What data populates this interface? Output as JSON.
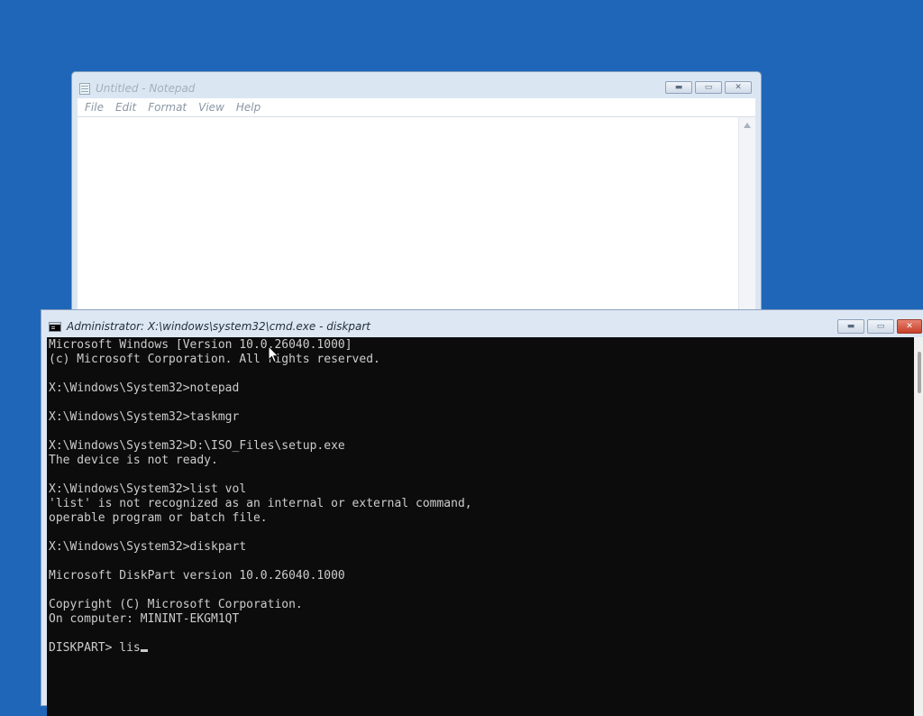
{
  "notepad": {
    "title": "Untitled - Notepad",
    "menu": [
      "File",
      "Edit",
      "Format",
      "View",
      "Help"
    ],
    "buttons": {
      "minimize": "▬",
      "maximize": "▭",
      "close": "✕"
    }
  },
  "cmd": {
    "title": "Administrator: X:\\windows\\system32\\cmd.exe - diskpart",
    "buttons": {
      "minimize": "▬",
      "maximize": "▭",
      "close": "✕"
    },
    "lines": [
      "Microsoft Windows [Version 10.0.26040.1000]",
      "(c) Microsoft Corporation. All rights reserved.",
      "",
      "X:\\Windows\\System32>notepad",
      "",
      "X:\\Windows\\System32>taskmgr",
      "",
      "X:\\Windows\\System32>D:\\ISO_Files\\setup.exe",
      "The device is not ready.",
      "",
      "X:\\Windows\\System32>list vol",
      "'list' is not recognized as an internal or external command,",
      "operable program or batch file.",
      "",
      "X:\\Windows\\System32>diskpart",
      "",
      "Microsoft DiskPart version 10.0.26040.1000",
      "",
      "Copyright (C) Microsoft Corporation.",
      "On computer: MININT-EKGM1QT",
      "",
      "DISKPART> lis"
    ]
  },
  "icons": {
    "notepad_icon": "notepad-icon",
    "cmd_icon": "cmd-icon",
    "pointer": "mouse-pointer-icon"
  }
}
